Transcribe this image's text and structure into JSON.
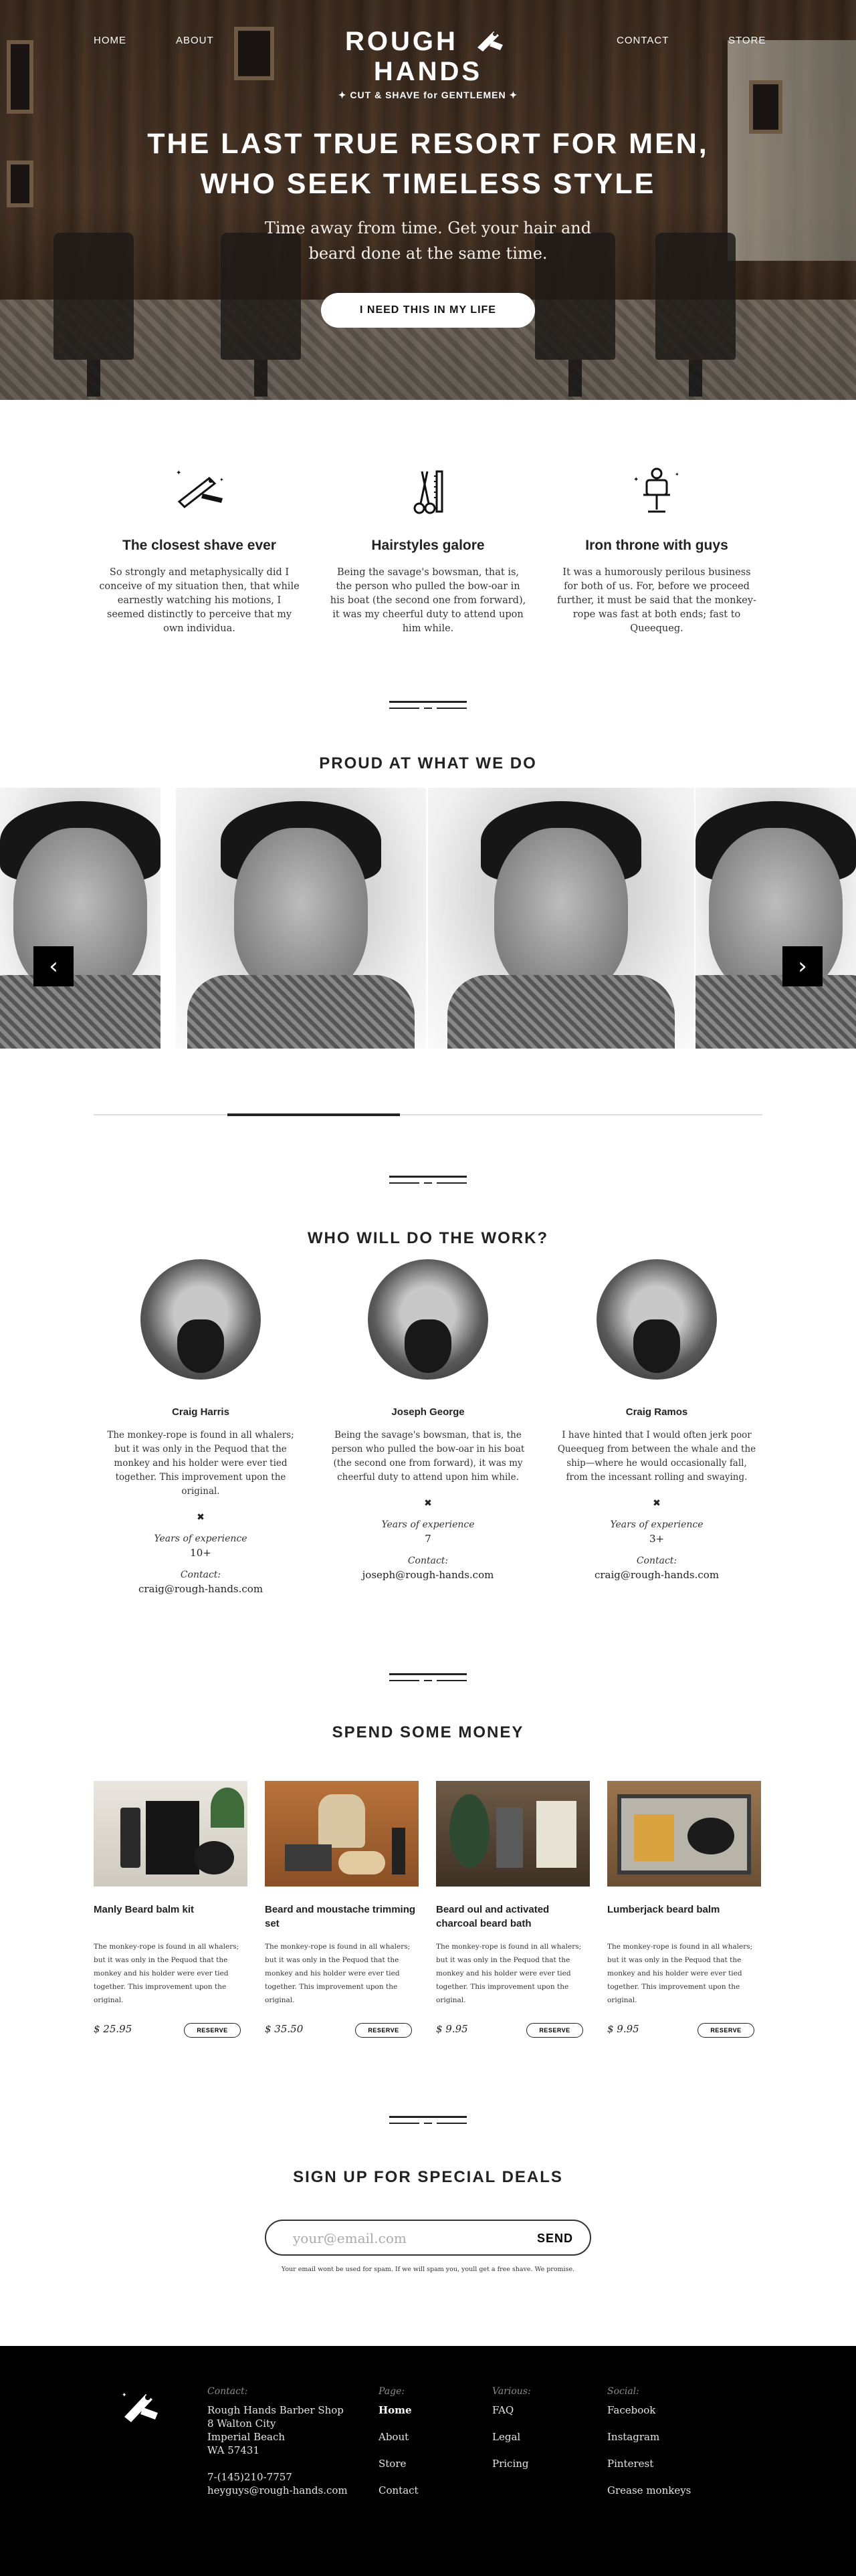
{
  "nav": {
    "home": "HOME",
    "about": "ABOUT",
    "contact": "CONTACT",
    "store": "STORE"
  },
  "logo": {
    "brand_left": "ROUGH",
    "brand_right": "HANDS",
    "tagline": "✦ CUT & SHAVE for GENTLEMEN ✦"
  },
  "hero": {
    "headline_1": "THE LAST TRUE RESORT FOR MEN,",
    "headline_2": "WHO SEEK TIMELESS STYLE",
    "sub_1": "Time away from time. Get your hair and",
    "sub_2": "beard done at the same time.",
    "cta": "I NEED THIS IN MY LIFE"
  },
  "features": [
    {
      "icon": "razor-icon",
      "title": "The closest shave ever",
      "text": "So strongly and metaphysically did I conceive of my situation then, that while earnestly watching his motions, I seemed distinctly to perceive that my own individua."
    },
    {
      "icon": "scissors-comb-icon",
      "title": "Hairstyles galore",
      "text": "Being the savage's bowsman, that is, the person who pulled the bow-oar in his boat (the second one from forward), it was my cheerful duty to attend upon him while."
    },
    {
      "icon": "barber-chair-icon",
      "title": "Iron throne with guys",
      "text": "It was a humorously perilous business for both of us. For, before we proceed further, it must be said that the monkey-rope was fast at both ends; fast to Queequeg."
    }
  ],
  "gallery": {
    "title": "PROUD AT WHAT WE DO",
    "prev": "‹",
    "next": "›",
    "position": 0.27
  },
  "team": {
    "title": "WHO WILL DO THE WORK?",
    "members": [
      {
        "name": "Craig Harris",
        "bio": "The monkey-rope is found in all whalers; but it was only in the Pequod that the monkey and his holder were ever tied together. This improvement upon the original.",
        "mark": "✖",
        "exp_label": "Years of experience",
        "exp": "10+",
        "contact_label": "Contact:",
        "email": "craig@rough-hands.com"
      },
      {
        "name": "Joseph George",
        "bio": "Being the savage's bowsman, that is, the person who pulled the bow-oar in his boat (the second one from forward), it was my cheerful duty to attend upon him while.",
        "mark": "✖",
        "exp_label": "Years of experience",
        "exp": "7",
        "contact_label": "Contact:",
        "email": "joseph@rough-hands.com"
      },
      {
        "name": "Craig Ramos",
        "bio": "I have hinted that I would often jerk poor Queequeg from between the whale and the ship—where he would occasionally fall, from the incessant rolling and swaying.",
        "mark": "✖",
        "exp_label": "Years of experience",
        "exp": "3+",
        "contact_label": "Contact:",
        "email": "craig@rough-hands.com"
      }
    ]
  },
  "shop": {
    "title": "SPEND SOME MONEY",
    "products": [
      {
        "name": "Manly Beard balm kit",
        "text": "The monkey-rope is found in all whalers; but it was only in the Pequod that the monkey and his holder were ever tied together. This improvement upon the original.",
        "price": "$ 25.95",
        "button": "RESERVE"
      },
      {
        "name": "Beard and moustache trimming set",
        "text": "The monkey-rope is found in all whalers; but it was only in the Pequod that the monkey and his holder were ever tied together. This improvement upon the original.",
        "price": "$ 35.50",
        "button": "RESERVE"
      },
      {
        "name": "Beard oul and activated charcoal beard bath",
        "text": "The monkey-rope is found in all whalers; but it was only in the Pequod that the monkey and his holder were ever tied together. This improvement upon the original.",
        "price": "$ 9.95",
        "button": "RESERVE"
      },
      {
        "name": "Lumberjack beard balm",
        "text": "The monkey-rope is found in all whalers; but it was only in the Pequod that the monkey and his holder were ever tied together. This improvement upon the original.",
        "price": "$ 9.95",
        "button": "RESERVE"
      }
    ]
  },
  "signup": {
    "title": "SIGN UP FOR SPECIAL DEALS",
    "placeholder": "your@email.com",
    "button": "SEND",
    "note": "Your email wont be used for spam. If we will spam you, youll get a free shave. We promise."
  },
  "footer": {
    "contact": {
      "head": "Contact:",
      "line1": "Rough Hands Barber Shop",
      "line2": "8 Walton City",
      "line3": "Imperial Beach",
      "line4": "WA 57431",
      "phone": "7-(145)210-7757",
      "email": "heyguys@rough-hands.com"
    },
    "page": {
      "head": "Page:",
      "links": [
        "Home",
        "About",
        "Store",
        "Contact"
      ]
    },
    "various": {
      "head": "Various:",
      "links": [
        "FAQ",
        "Legal",
        "Pricing"
      ]
    },
    "social": {
      "head": "Social:",
      "links": [
        "Facebook",
        "Instagram",
        "Pinterest",
        "Grease monkeys"
      ]
    }
  },
  "colors": {
    "dark": "#000000",
    "text": "#222222",
    "hero_overlay": "#3a2a1e"
  }
}
